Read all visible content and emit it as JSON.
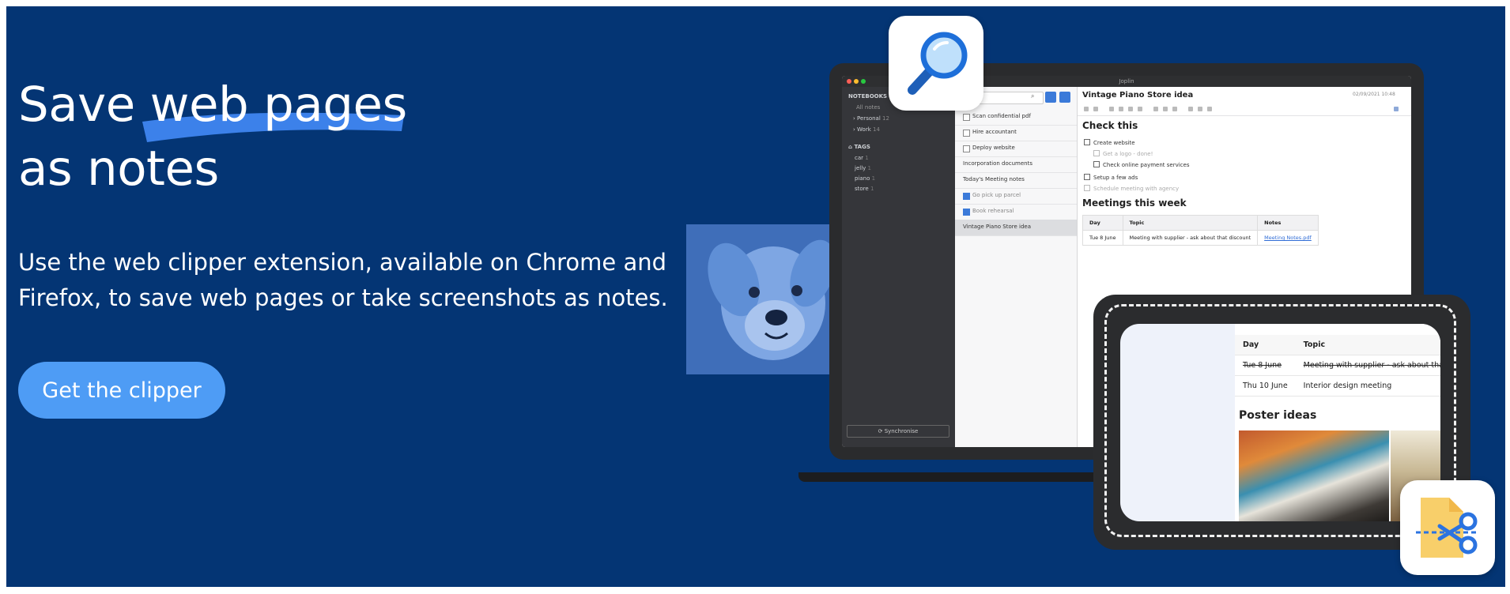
{
  "hero": {
    "title_line1_a": "Save ",
    "title_line1_b": "web pages",
    "title_line2": "as notes",
    "description": "Use the web clipper extension, available on Chrome and Firefox, to save web pages or take screenshots as notes.",
    "cta_label": "Get the clipper"
  },
  "colors": {
    "hero_bg": "#043574",
    "accent_blue": "#4e9cf5"
  },
  "app": {
    "window_title": "Joplin",
    "sidebar": {
      "notebooks_header": "NOTEBOOKS",
      "all_notes": "All notes",
      "notebooks": [
        {
          "name": "Personal",
          "count": "12"
        },
        {
          "name": "Work",
          "count": "14"
        }
      ],
      "tags_header": "TAGS",
      "tags": [
        {
          "name": "car",
          "count": "1"
        },
        {
          "name": "jelly",
          "count": "1"
        },
        {
          "name": "piano",
          "count": "1"
        },
        {
          "name": "store",
          "count": "1"
        }
      ],
      "sync_label": "Synchronise"
    },
    "notes": [
      {
        "title": "Scan confidential pdf",
        "check": "off"
      },
      {
        "title": "Hire accountant",
        "check": "off"
      },
      {
        "title": "Deploy website",
        "check": "off"
      },
      {
        "title": "Incorporation documents",
        "check": "none"
      },
      {
        "title": "Today's Meeting notes",
        "check": "none"
      },
      {
        "title": "Go pick up parcel",
        "check": "on"
      },
      {
        "title": "Book rehearsal",
        "check": "on"
      },
      {
        "title": "Vintage Piano Store idea",
        "check": "none"
      }
    ],
    "editor": {
      "title": "Vintage Piano Store idea",
      "date": "02/09/2021 10:48",
      "section1": "Check this",
      "checklist": [
        {
          "label": "Create website",
          "done": false,
          "indent": 0
        },
        {
          "label": "Get a logo - done!",
          "done": true,
          "indent": 1
        },
        {
          "label": "Check online payment services",
          "done": false,
          "indent": 1
        },
        {
          "label": "Setup a few ads",
          "done": false,
          "indent": 0
        },
        {
          "label": "Schedule meeting with agency",
          "done": true,
          "indent": 0
        }
      ],
      "section2": "Meetings this week",
      "table_headers": [
        "Day",
        "Topic",
        "Notes"
      ],
      "table_row": [
        "Tue 8 June",
        "Meeting with supplier - ask about that discount",
        "Meeting Notes.pdf"
      ]
    }
  },
  "clip": {
    "table_headers": [
      "Day",
      "Topic"
    ],
    "rows": [
      [
        "Tue 8 June",
        "Meeting with supplier - ask about that dis"
      ],
      [
        "Thu 10 June",
        "Interior design meeting"
      ]
    ],
    "poster_heading": "Poster ideas"
  },
  "icons": {
    "search": "magnifier-icon",
    "clipper": "scissors-document-icon"
  }
}
